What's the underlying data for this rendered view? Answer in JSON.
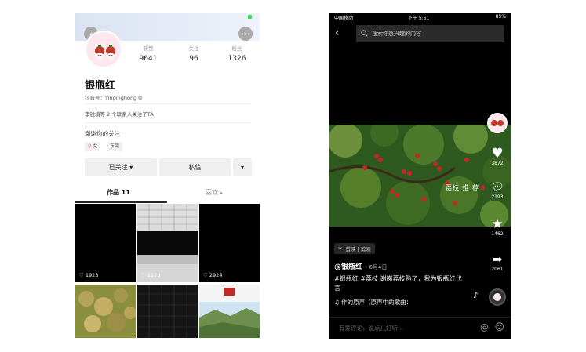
{
  "profile": {
    "stats": [
      {
        "label": "获赞",
        "value": "9641"
      },
      {
        "label": "关注",
        "value": "96"
      },
      {
        "label": "粉丝",
        "value": "1326"
      }
    ],
    "name": "银瓶红",
    "douyin_id": "抖音号：Yinpinghong",
    "contact_note": "李锐填等 2 个联系人关注了TA",
    "bio": "谢谢你的关注",
    "tags": [
      "女",
      "东莞"
    ],
    "follow_button": "已关注 ▾",
    "message_button": "私信",
    "more_button": "▾",
    "tabs": {
      "works": "作品 11",
      "likes": "喜欢"
    },
    "grid": [
      {
        "likes": "1923"
      },
      {
        "likes": "1128"
      },
      {
        "likes": "2924"
      }
    ]
  },
  "video": {
    "status": {
      "carrier": "中国移动",
      "time": "下午 5:51",
      "battery": "85%"
    },
    "search_placeholder": "搜索你感兴趣的内容",
    "side": {
      "likes": "3872",
      "comments": "2193",
      "favorites": "1462",
      "shares": "2061"
    },
    "overlay_text": "荔枝 推 荐",
    "capcut_chip": "剪映 | 剪映",
    "author": "@银瓶红",
    "date": "· 6月4日",
    "description": "#银瓶红 #荔枝 谢岗荔枝熟了，我为银瓶红代言",
    "music": "作的原声（原声中的歌曲：",
    "comment_placeholder": "有爱评论，说点儿好听…",
    "accent": "#fe2c55"
  }
}
